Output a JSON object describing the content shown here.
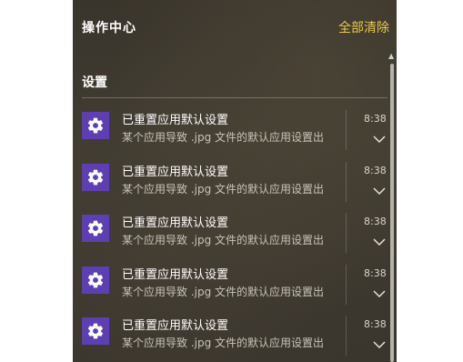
{
  "action_center": {
    "title": "操作中心",
    "clear_all_label": "全部清除",
    "accent_color": "#e8c84a"
  },
  "section": {
    "title": "设置"
  },
  "notifications": [
    {
      "icon": "gear-icon",
      "title": "已重置应用默认设置",
      "body": "某个应用导致 .jpg 文件的默认应用设置出",
      "time": "8:38"
    },
    {
      "icon": "gear-icon",
      "title": "已重置应用默认设置",
      "body": "某个应用导致 .jpg 文件的默认应用设置出",
      "time": "8:38"
    },
    {
      "icon": "gear-icon",
      "title": "已重置应用默认设置",
      "body": "某个应用导致 .jpg 文件的默认应用设置出",
      "time": "8:38"
    },
    {
      "icon": "gear-icon",
      "title": "已重置应用默认设置",
      "body": "某个应用导致 .jpg 文件的默认应用设置出",
      "time": "8:38"
    },
    {
      "icon": "gear-icon",
      "title": "已重置应用默认设置",
      "body": "某个应用导致 .jpg 文件的默认应用设置出",
      "time": "8:38"
    }
  ],
  "colors": {
    "panel_bg": "#3d382f",
    "icon_bg": "#5e3fb3"
  }
}
